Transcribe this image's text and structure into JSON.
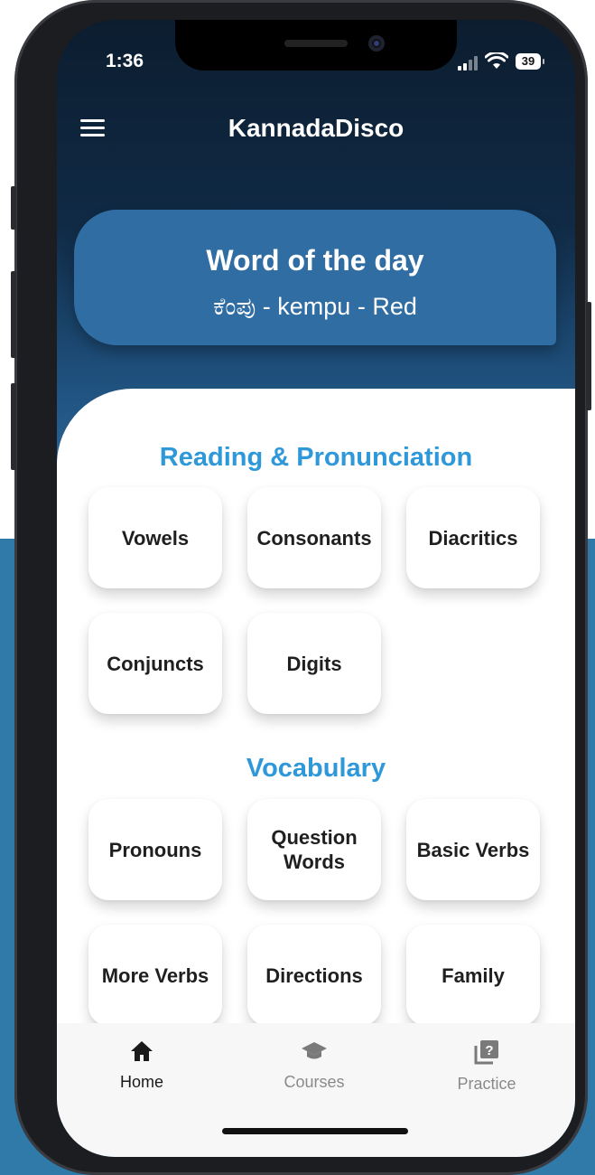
{
  "status_bar": {
    "time": "1:36",
    "battery": "39"
  },
  "header": {
    "title": "KannadaDisco"
  },
  "word_of_the_day": {
    "title": "Word of the day",
    "word": "ಕೆಂಪು - kempu - Red"
  },
  "sections": {
    "reading": {
      "title": "Reading & Pronunciation",
      "items": [
        "Vowels",
        "Consonants",
        "Diacritics",
        "Conjuncts",
        "Digits"
      ]
    },
    "vocabulary": {
      "title": "Vocabulary",
      "items": [
        "Pronouns",
        "Question Words",
        "Basic Verbs",
        "More Verbs",
        "Directions",
        "Family"
      ]
    }
  },
  "tab_bar": {
    "tabs": [
      {
        "label": "Home",
        "icon": "home-icon",
        "active": true
      },
      {
        "label": "Courses",
        "icon": "graduation-cap-icon",
        "active": false
      },
      {
        "label": "Practice",
        "icon": "question-box-icon",
        "active": false
      }
    ]
  },
  "colors": {
    "accent": "#2e98d8",
    "word_card": "#2f6da3",
    "background_panel": "#2f7aa8",
    "active_tab": "#1a1a1a",
    "inactive_tab": "#8a8a8a"
  }
}
